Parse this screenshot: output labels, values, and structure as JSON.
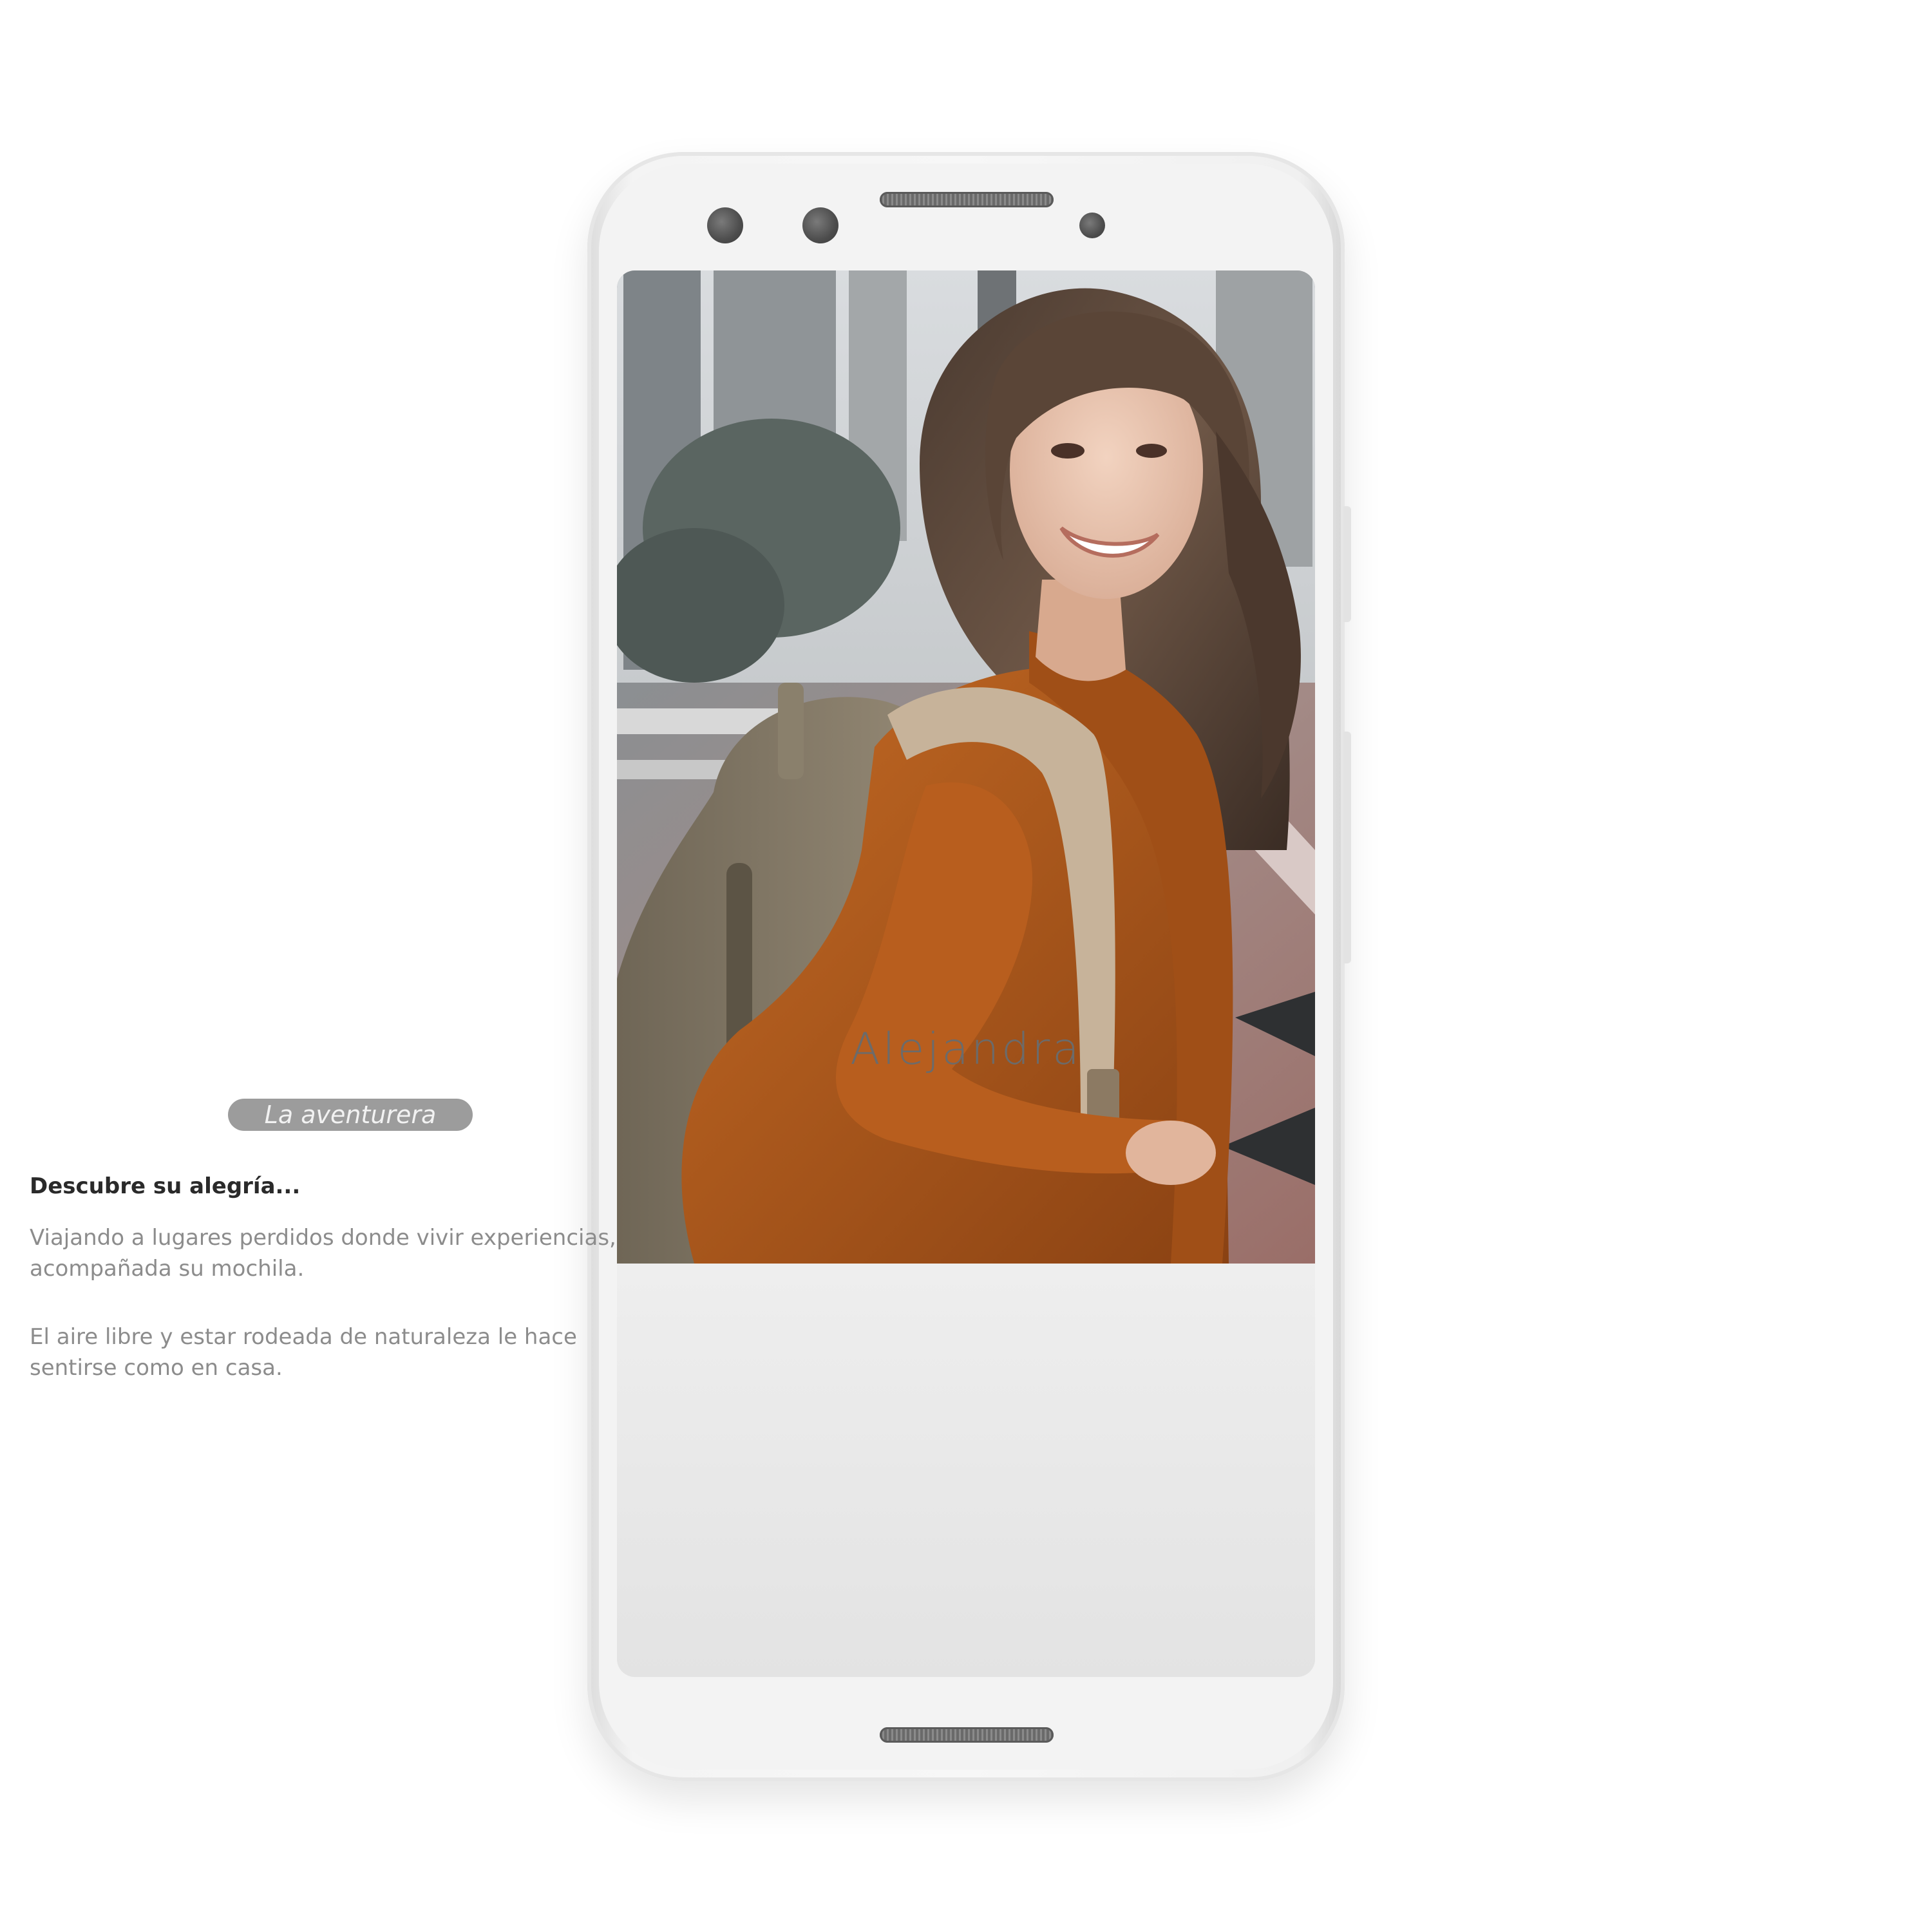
{
  "profile": {
    "name": "Alejandra",
    "tagline": "La aventurera",
    "section_heading": "Descubre su alegría...",
    "paragraphs": [
      "Viajando a lugares perdidos donde vivir experiencias, acompañada su mochila.",
      "El aire libre y estar rodeada de naturaleza le hace sentirse como en casa."
    ]
  },
  "colors": {
    "tag_background": "#9c9c9c",
    "card_background": "#e6e6e6",
    "name_text": "#6b6b6b",
    "body_text": "#8c8c8c",
    "sweater": "#b5601e"
  }
}
